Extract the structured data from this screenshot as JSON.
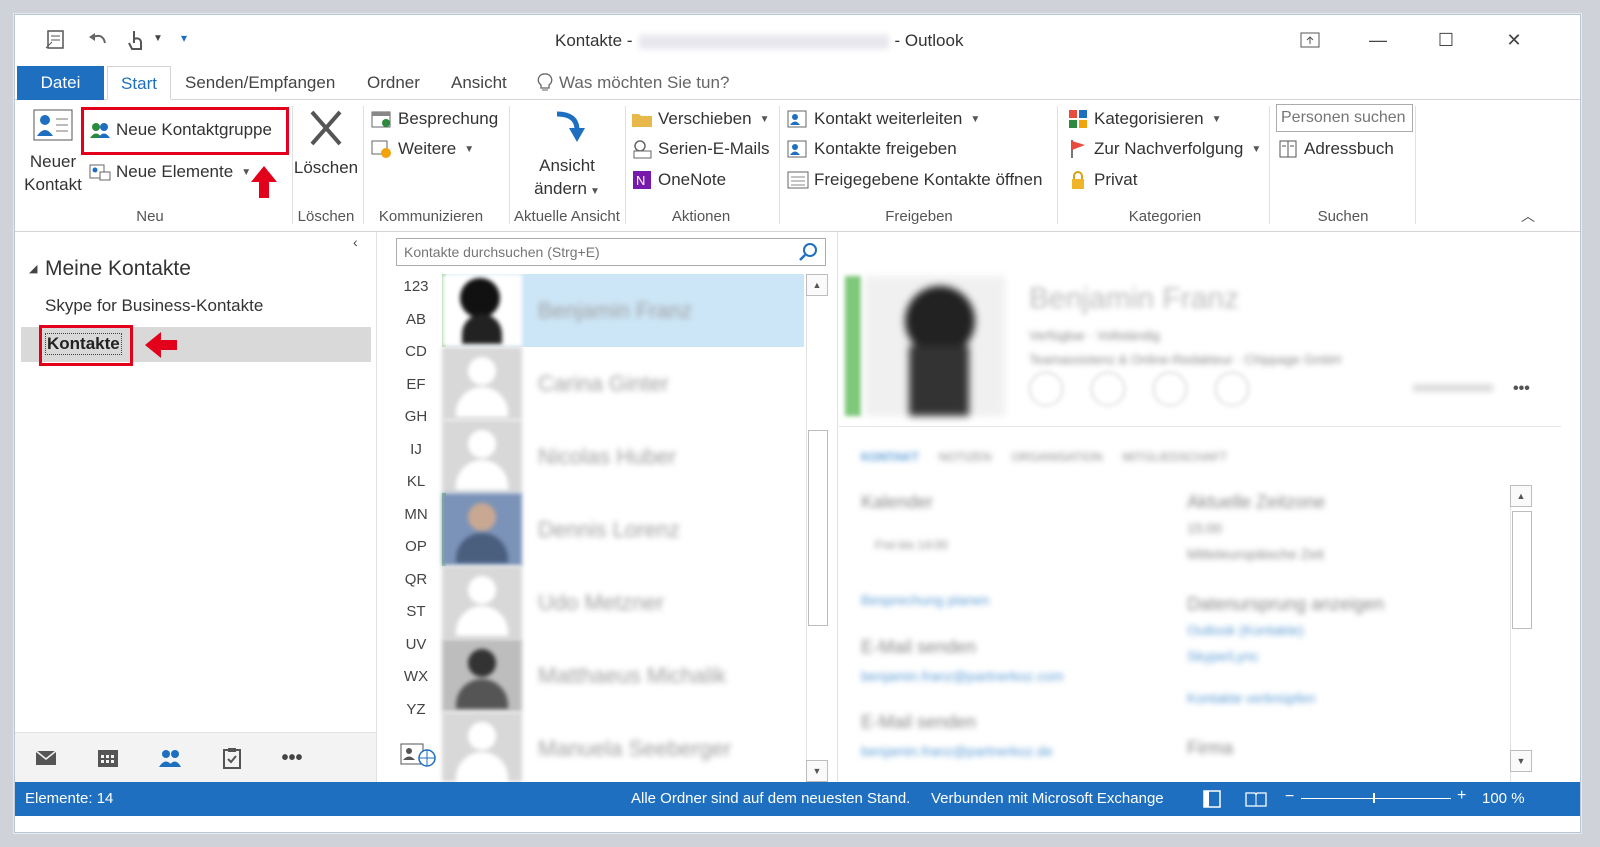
{
  "window": {
    "title_prefix": "Kontakte -",
    "title_suffix": "- Outlook",
    "minimize": "—",
    "maximize": "☐",
    "close": "✕"
  },
  "tabs": [
    {
      "label": "Datei"
    },
    {
      "label": "Start"
    },
    {
      "label": "Senden/Empfangen"
    },
    {
      "label": "Ordner"
    },
    {
      "label": "Ansicht"
    },
    {
      "label": "Was möchten Sie tun?"
    }
  ],
  "ribbon": {
    "neu": {
      "group_label": "Neu",
      "new_contact_line1": "Neuer",
      "new_contact_line2": "Kontakt",
      "new_group": "Neue Kontaktgruppe",
      "new_items": "Neue Elemente"
    },
    "loeschen": {
      "group_label": "Löschen",
      "delete": "Löschen"
    },
    "kommunizieren": {
      "group_label": "Kommunizieren",
      "meeting": "Besprechung",
      "more": "Weitere"
    },
    "ansicht": {
      "group_label": "Aktuelle Ansicht",
      "change_line1": "Ansicht",
      "change_line2": "ändern"
    },
    "aktionen": {
      "group_label": "Aktionen",
      "move": "Verschieben",
      "mail_merge": "Serien-E-Mails",
      "onenote": "OneNote"
    },
    "freigeben": {
      "group_label": "Freigeben",
      "forward": "Kontakt weiterleiten",
      "share": "Kontakte freigeben",
      "open_shared": "Freigegebene Kontakte öffnen"
    },
    "kategorien": {
      "group_label": "Kategorien",
      "categorize": "Kategorisieren",
      "followup": "Zur Nachverfolgung",
      "private": "Privat"
    },
    "suchen": {
      "group_label": "Suchen",
      "search_placeholder": "Personen suchen",
      "address_book": "Adressbuch"
    }
  },
  "folders": {
    "section_title": "Meine Kontakte",
    "items": [
      {
        "label": "Skype for Business-Kontakte"
      },
      {
        "label": "Kontakte"
      }
    ]
  },
  "contacts": {
    "search_placeholder": "Kontakte durchsuchen (Strg+E)",
    "alpha_index": [
      "123",
      "AB",
      "CD",
      "EF",
      "GH",
      "IJ",
      "KL",
      "MN",
      "OP",
      "QR",
      "ST",
      "UV",
      "WX",
      "YZ"
    ],
    "list": [
      {
        "name": "Benjamin Franz"
      },
      {
        "name": "Carina Ginter"
      },
      {
        "name": "Nicolas Huber"
      },
      {
        "name": "Dennis Lorenz"
      },
      {
        "name": "Udo Metzner"
      },
      {
        "name": "Matthaeus Michalik"
      },
      {
        "name": "Manuela Seeberger"
      }
    ]
  },
  "reading_pane": {
    "name": "Benjamin Franz",
    "line1": "Verfügbar · Vollständig",
    "line2": "Teamassistenz & Online-Redakteur · Chippage GmbH",
    "more": "•••",
    "tabs": [
      "KONTAKT",
      "NOTIZEN",
      "ORGANISATION",
      "MITGLIEDSCHAFT"
    ],
    "left_col": [
      "Kalender",
      "Frei bis 14:00",
      "Besprechung planen",
      "E-Mail senden",
      "benjamin.franz@partnerkoz.com",
      "E-Mail senden",
      "benjamin.franz@partnerkoz.de"
    ],
    "right_col": [
      "Aktuelle Zeitzone",
      "15:00",
      "Mitteleuropäische Zeit",
      "Datenursprung anzeigen",
      "Outlook (Kontakte)",
      "Skype/Lync",
      "Kontakte verknüpfen",
      "Firma"
    ]
  },
  "nav": {
    "mail": "mail-icon",
    "calendar": "calendar-icon",
    "people": "people-icon",
    "tasks": "tasks-icon",
    "more": "•••"
  },
  "status": {
    "items_count": "Elemente: 14",
    "sync_state": "Alle Ordner sind auf dem neuesten Stand.",
    "connection": "Verbunden mit Microsoft Exchange",
    "zoom": "100 %"
  },
  "colors": {
    "accent": "#1e6fc0",
    "highlight": "#e3001b",
    "selected_row": "#cde6f7"
  }
}
